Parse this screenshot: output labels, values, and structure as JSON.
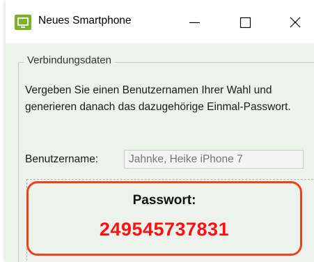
{
  "window": {
    "title": "Neues Smartphone",
    "icon": "smartphone-app-icon"
  },
  "titlebar_buttons": {
    "minimize": "minimize-icon",
    "maximize": "maximize-icon",
    "close": "close-icon"
  },
  "group": {
    "title": "Verbindungsdaten",
    "description": "Vergeben Sie einen Benutzernamen Ihrer Wahl und generieren danach das dazugehörige Einmal-Passwort."
  },
  "username": {
    "label": "Benutzername:",
    "placeholder": "Jahnke, Heike iPhone 7"
  },
  "password": {
    "label": "Passwort:",
    "value": "249545737831"
  },
  "colors": {
    "window_bg": "#eef2ec",
    "highlight_border": "#e8431b",
    "password_text": "#ff1010",
    "app_icon": "#7bb327"
  }
}
